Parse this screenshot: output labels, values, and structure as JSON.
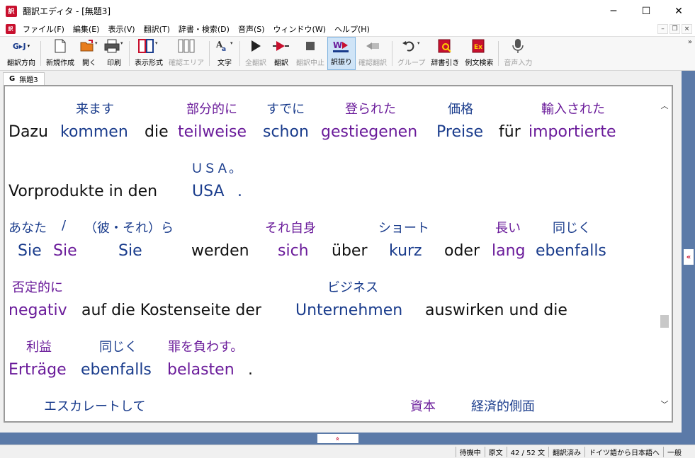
{
  "window": {
    "app_icon": "訳",
    "title": "翻訳エディタ - [無題3]",
    "minimize": "─",
    "maximize": "☐",
    "close": "✕"
  },
  "menu": {
    "icon": "訳",
    "items": [
      "ファイル(F)",
      "編集(E)",
      "表示(V)",
      "翻訳(T)",
      "辞書・検索(D)",
      "音声(S)",
      "ウィンドウ(W)",
      "ヘルプ(H)"
    ],
    "mdi_minimize": "–",
    "mdi_restore": "❐",
    "mdi_close": "×"
  },
  "toolbar": {
    "direction_icon_text": "G▸J",
    "direction_label": "翻訳方向",
    "new_label": "新規作成",
    "open_label": "開く",
    "print_label": "印刷",
    "view_label": "表示形式",
    "confirm_area_label": "確認エリア",
    "font_label": "文字",
    "translate_all_label": "全翻訳",
    "translate_label": "翻訳",
    "stop_label": "翻訳中止",
    "furigana_label": "訳振り",
    "confirm_translate_label": "確認翻訳",
    "group_label": "グループ",
    "dict_label": "辞書引き",
    "example_label": "例文検索",
    "voice_label": "音声入力",
    "more": "»"
  },
  "tab": {
    "icon": "G",
    "label": "無題3"
  },
  "document": {
    "lines": [
      {
        "jp": [
          {
            "t": "来ます",
            "c": "blue"
          },
          {
            "t": "部分的に",
            "c": "purple"
          },
          {
            "t": "すでに",
            "c": "blue"
          },
          {
            "t": "登られた",
            "c": "purple"
          },
          {
            "t": "価格",
            "c": "blue"
          },
          {
            "t": "輸入された",
            "c": "purple"
          }
        ],
        "de": [
          {
            "t": "Dazu",
            "c": "black"
          },
          {
            "t": "kommen",
            "c": "blue"
          },
          {
            "t": "die",
            "c": "black"
          },
          {
            "t": "teilweise",
            "c": "purple"
          },
          {
            "t": "schon",
            "c": "blue"
          },
          {
            "t": "gestiegenen",
            "c": "purple"
          },
          {
            "t": "Preise",
            "c": "blue"
          },
          {
            "t": "für",
            "c": "black"
          },
          {
            "t": "importierte",
            "c": "purple"
          }
        ]
      },
      {
        "jp": [
          {
            "t": "ＵＳＡ。",
            "c": "blue"
          }
        ],
        "de": [
          {
            "t": "Vorprodukte in den",
            "c": "black"
          },
          {
            "t": "USA",
            "c": "blue"
          },
          {
            "t": ".",
            "c": "blue"
          }
        ]
      },
      {
        "jp": [
          {
            "t": "あなた",
            "c": "blue"
          },
          {
            "t": "/",
            "c": "blue"
          },
          {
            "t": "（彼・それ）ら",
            "c": "blue"
          },
          {
            "t": "それ自身",
            "c": "purple"
          },
          {
            "t": "ショート",
            "c": "blue"
          },
          {
            "t": "長い",
            "c": "purple"
          },
          {
            "t": "同じく",
            "c": "blue"
          }
        ],
        "de": [
          {
            "t": "Sie",
            "c": "blue"
          },
          {
            "t": "Sie",
            "c": "purple"
          },
          {
            "t": "Sie",
            "c": "blue"
          },
          {
            "t": "werden",
            "c": "black"
          },
          {
            "t": "sich",
            "c": "purple"
          },
          {
            "t": "über",
            "c": "black"
          },
          {
            "t": "kurz",
            "c": "blue"
          },
          {
            "t": "oder",
            "c": "black"
          },
          {
            "t": "lang",
            "c": "purple"
          },
          {
            "t": "ebenfalls",
            "c": "blue"
          }
        ]
      },
      {
        "jp": [
          {
            "t": "否定的に",
            "c": "purple"
          },
          {
            "t": "ビジネス",
            "c": "blue"
          }
        ],
        "de": [
          {
            "t": "negativ",
            "c": "purple"
          },
          {
            "t": "auf die Kostenseite der",
            "c": "black"
          },
          {
            "t": "Unternehmen",
            "c": "blue"
          },
          {
            "t": "auswirken und die",
            "c": "black"
          }
        ]
      },
      {
        "jp": [
          {
            "t": "利益",
            "c": "purple"
          },
          {
            "t": "同じく",
            "c": "blue"
          },
          {
            "t": "罪を負わす。",
            "c": "purple"
          }
        ],
        "de": [
          {
            "t": "Erträge",
            "c": "purple"
          },
          {
            "t": "ebenfalls",
            "c": "blue"
          },
          {
            "t": "belasten",
            "c": "purple"
          },
          {
            "t": ".",
            "c": "black"
          }
        ]
      },
      {
        "jp": [
          {
            "t": "エスカレートして",
            "c": "blue"
          },
          {
            "t": "資本",
            "c": "purple"
          },
          {
            "t": "経済的側面",
            "c": "blue"
          }
        ],
        "de": []
      }
    ]
  },
  "scroll": {
    "up": "︿",
    "down": "﹀"
  },
  "panels": {
    "right_toggle": "«",
    "bottom_toggle": "»"
  },
  "status": {
    "state": "待機中",
    "mode": "原文",
    "position": "42 / 52 文",
    "translated": "翻訳済み",
    "direction": "ドイツ語から日本語へ",
    "field": "一般"
  }
}
